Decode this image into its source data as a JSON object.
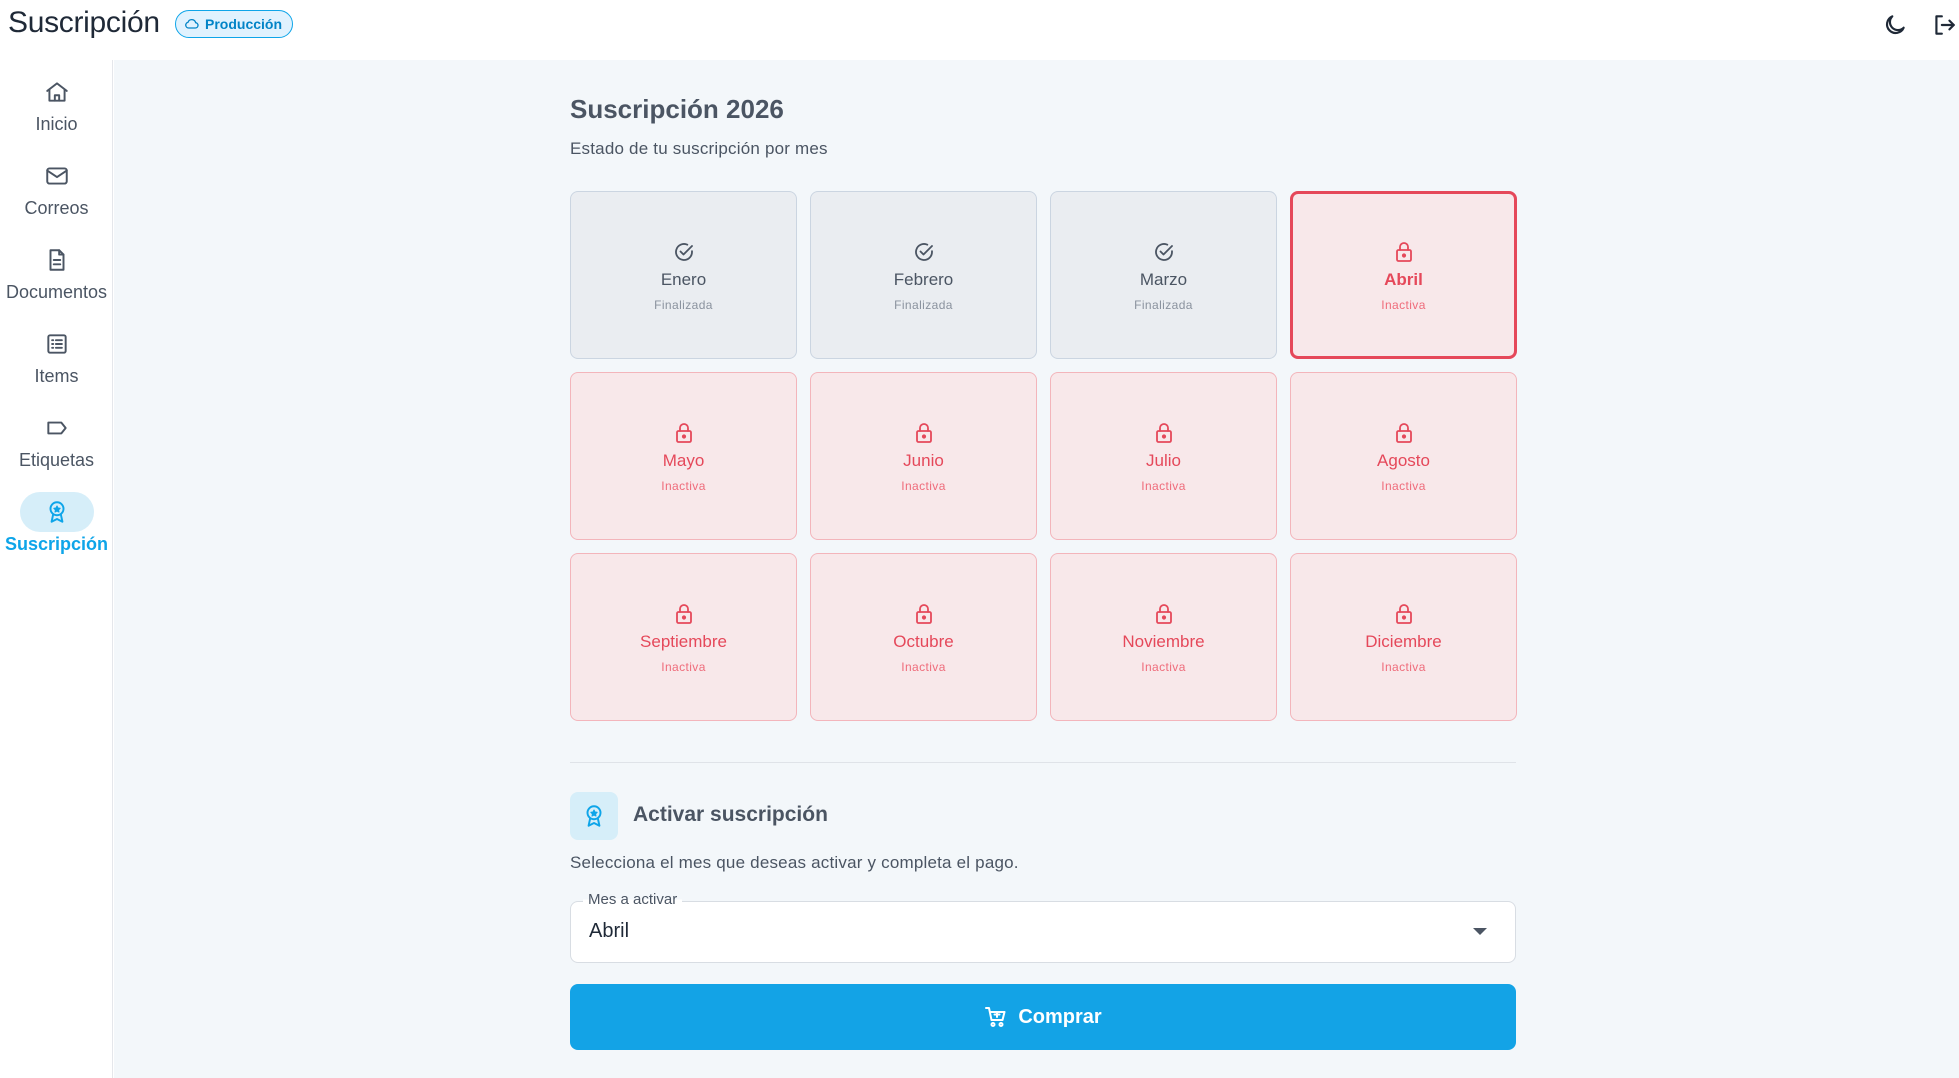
{
  "header": {
    "title": "Suscripción",
    "env_badge": "Producción",
    "icons": [
      "cloud-icon",
      "moon-icon",
      "logout-icon"
    ]
  },
  "sidebar": {
    "items": [
      {
        "label": "Inicio",
        "icon": "home-icon",
        "active": false
      },
      {
        "label": "Correos",
        "icon": "mail-icon",
        "active": false
      },
      {
        "label": "Documentos",
        "icon": "document-icon",
        "active": false
      },
      {
        "label": "Items",
        "icon": "list-icon",
        "active": false
      },
      {
        "label": "Etiquetas",
        "icon": "tag-icon",
        "active": false
      },
      {
        "label": "Suscripción",
        "icon": "award-icon",
        "active": true
      }
    ]
  },
  "main": {
    "title": "Suscripción 2026",
    "subtitle": "Estado de tu suscripción por mes",
    "months": [
      {
        "name": "Enero",
        "status": "Finalizada",
        "state": "done",
        "icon": "check-circle-icon"
      },
      {
        "name": "Febrero",
        "status": "Finalizada",
        "state": "done",
        "icon": "check-circle-icon"
      },
      {
        "name": "Marzo",
        "status": "Finalizada",
        "state": "done",
        "icon": "check-circle-icon"
      },
      {
        "name": "Abril",
        "status": "Inactiva",
        "state": "selected",
        "icon": "lock-icon"
      },
      {
        "name": "Mayo",
        "status": "Inactiva",
        "state": "inactive",
        "icon": "lock-icon"
      },
      {
        "name": "Junio",
        "status": "Inactiva",
        "state": "inactive",
        "icon": "lock-icon"
      },
      {
        "name": "Julio",
        "status": "Inactiva",
        "state": "inactive",
        "icon": "lock-icon"
      },
      {
        "name": "Agosto",
        "status": "Inactiva",
        "state": "inactive",
        "icon": "lock-icon"
      },
      {
        "name": "Septiembre",
        "status": "Inactiva",
        "state": "inactive",
        "icon": "lock-icon"
      },
      {
        "name": "Octubre",
        "status": "Inactiva",
        "state": "inactive",
        "icon": "lock-icon"
      },
      {
        "name": "Noviembre",
        "status": "Inactiva",
        "state": "inactive",
        "icon": "lock-icon"
      },
      {
        "name": "Diciembre",
        "status": "Inactiva",
        "state": "inactive",
        "icon": "lock-icon"
      }
    ],
    "activate": {
      "title": "Activar suscripción",
      "description": "Selecciona el mes que deseas activar y completa el pago.",
      "select_label": "Mes a activar",
      "select_value": "Abril",
      "buy_label": "Comprar",
      "buy_icon": "cart-icon"
    }
  },
  "colors": {
    "accent": "#13a3e6",
    "inactive": "#e5485a",
    "inactive_bg": "#f8e8ea",
    "done_bg": "#eaedf1",
    "main_bg": "#f3f7fa"
  }
}
